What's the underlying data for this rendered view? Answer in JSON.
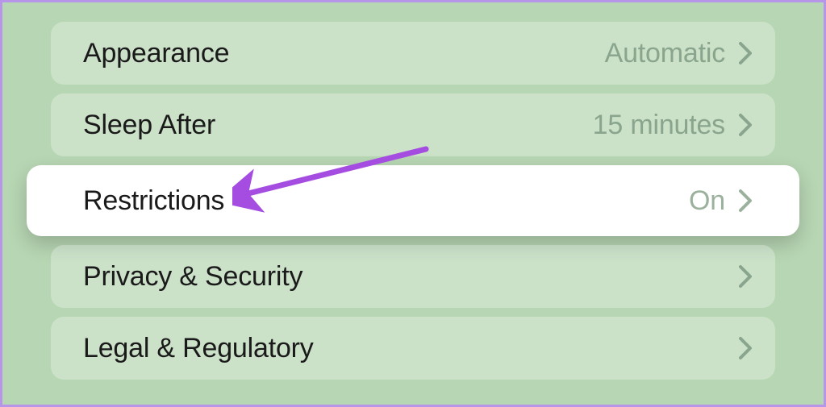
{
  "settings": {
    "rows": [
      {
        "label": "Appearance",
        "value": "Automatic",
        "highlight": false
      },
      {
        "label": "Sleep After",
        "value": "15 minutes",
        "highlight": false
      },
      {
        "label": "Restrictions",
        "value": "On",
        "highlight": true
      },
      {
        "label": "Privacy & Security",
        "value": "",
        "highlight": false
      },
      {
        "label": "Legal & Regulatory",
        "value": "",
        "highlight": false
      }
    ]
  },
  "annotation": {
    "arrow_color": "#a44de0"
  }
}
